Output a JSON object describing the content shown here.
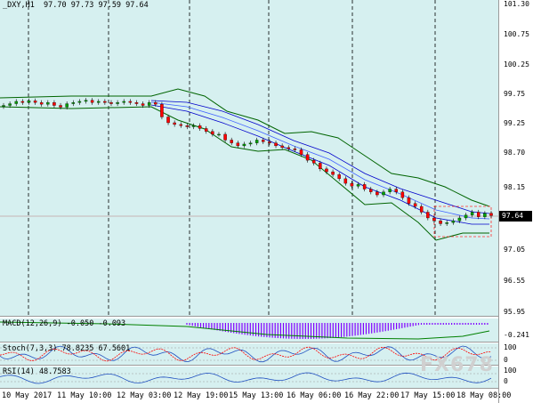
{
  "chart": {
    "symbol_line": "_DXY,H1  97.70 97.73 97.59 97.64",
    "current_price": "97.64",
    "price_ticks": [
      "101.30",
      "100.75",
      "100.25",
      "99.75",
      "99.25",
      "98.70",
      "98.15",
      "97.05",
      "96.55",
      "95.95"
    ],
    "time_labels": [
      "10 May 2017",
      "11 May 10:00",
      "12 May 03:00",
      "12 May 19:00",
      "15 May 13:00",
      "16 May 06:00",
      "16 May 22:00",
      "17 May 15:00",
      "18 May 08:00"
    ]
  },
  "indicators": {
    "macd_label": "MACD(12,26,9) -0.050 -0.093",
    "macd_scale": "-0.241",
    "stoch_label": "Stoch(7,3,3) 78.8235 67.5601",
    "stoch_scale_top": "100",
    "stoch_scale_bottom": "0",
    "rsi_label": "RSI(14) 48.7583",
    "rsi_scale_top": "100",
    "rsi_scale_bottom": "0"
  },
  "watermark": "FX678",
  "colors": {
    "background": "#d6f0f0",
    "bull_candle": "#00a000",
    "bear_candle": "#ff0000",
    "bollinger": "#006400",
    "envelope": "#0000cc",
    "macd": "#8000ff",
    "stoch_main": "#2050c0",
    "stoch_signal": "#ff0000",
    "rsi": "#2050c0"
  },
  "chart_data": {
    "type": "candlestick",
    "closes": [
      99.55,
      99.58,
      99.62,
      99.6,
      99.63,
      99.6,
      99.57,
      99.6,
      99.55,
      99.52,
      99.58,
      99.6,
      99.62,
      99.64,
      99.6,
      99.62,
      99.6,
      99.58,
      99.6,
      99.62,
      99.6,
      99.58,
      99.55,
      99.6,
      99.57,
      99.35,
      99.25,
      99.22,
      99.2,
      99.18,
      99.2,
      99.15,
      99.1,
      99.05,
      99.05,
      98.95,
      98.9,
      98.85,
      98.88,
      98.9,
      98.95,
      98.92,
      98.9,
      98.85,
      98.82,
      98.8,
      98.78,
      98.7,
      98.6,
      98.55,
      98.45,
      98.4,
      98.35,
      98.28,
      98.2,
      98.15,
      98.18,
      98.1,
      98.05,
      98.0,
      98.05,
      98.1,
      98.05,
      97.95,
      97.85,
      97.8,
      97.7,
      97.6,
      97.55,
      97.5,
      97.52,
      97.55,
      97.6,
      97.65,
      97.7,
      97.62,
      97.68,
      97.64
    ]
  }
}
